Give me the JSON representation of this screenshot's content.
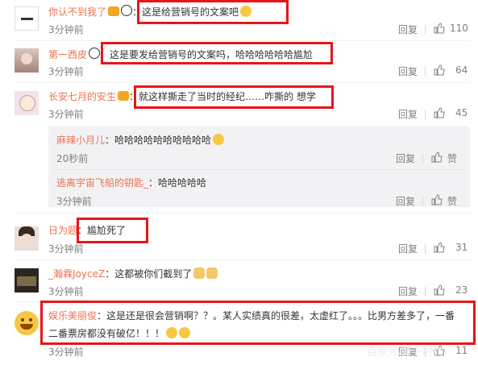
{
  "comments": [
    {
      "name": "你认不到我了",
      "text": "这是给营销号的文案吧",
      "time": "3分钟前",
      "reply": "回复",
      "likes": "110"
    },
    {
      "name": "第一西皮",
      "text": "这是要发给营销号的文案吗，哈哈哈哈哈哈尴尬",
      "time": "3分钟前",
      "reply": "回复",
      "likes": "64"
    },
    {
      "name": "长安七月的安生",
      "text": "就这样撕走了当时的经纪……咋撕的 想学",
      "time": "3分钟前",
      "reply": "回复",
      "likes": "45"
    },
    {
      "name": "日为题",
      "text": "尴尬死了",
      "time": "3分钟前",
      "reply": "回复",
      "likes": "31"
    },
    {
      "name": "_瀚霖JoyceZ",
      "text": "这都被你们截到了",
      "time": "3分钟前",
      "reply": "回复",
      "likes": "23"
    },
    {
      "name": "娱乐美丽俊",
      "text_line1": "这是还是很会营销啊？？。某人实绩真的很差，太虚红了。。。比男方差多了，一番",
      "text_line2": "二番票房都没有破亿！！！",
      "time": "3分钟前",
      "reply": "回复",
      "likes": "11"
    }
  ],
  "replies": [
    {
      "name": "麻辣小月儿",
      "text": "哈哈哈哈哈哈哈哈哈哈",
      "time": "20秒前",
      "reply": "回复",
      "like_label": "赞"
    },
    {
      "name": "逃离宇宙飞船的钥匙_",
      "text": "哈哈哈哈哈",
      "time": "3分钟前",
      "reply": "回复",
      "like_label": "赞"
    }
  ],
  "separator": "：",
  "watermark": "百家号/第一时尚",
  "colors": {
    "username": "#eb7350",
    "highlight_box": "#e8151c",
    "meta": "#808080"
  }
}
